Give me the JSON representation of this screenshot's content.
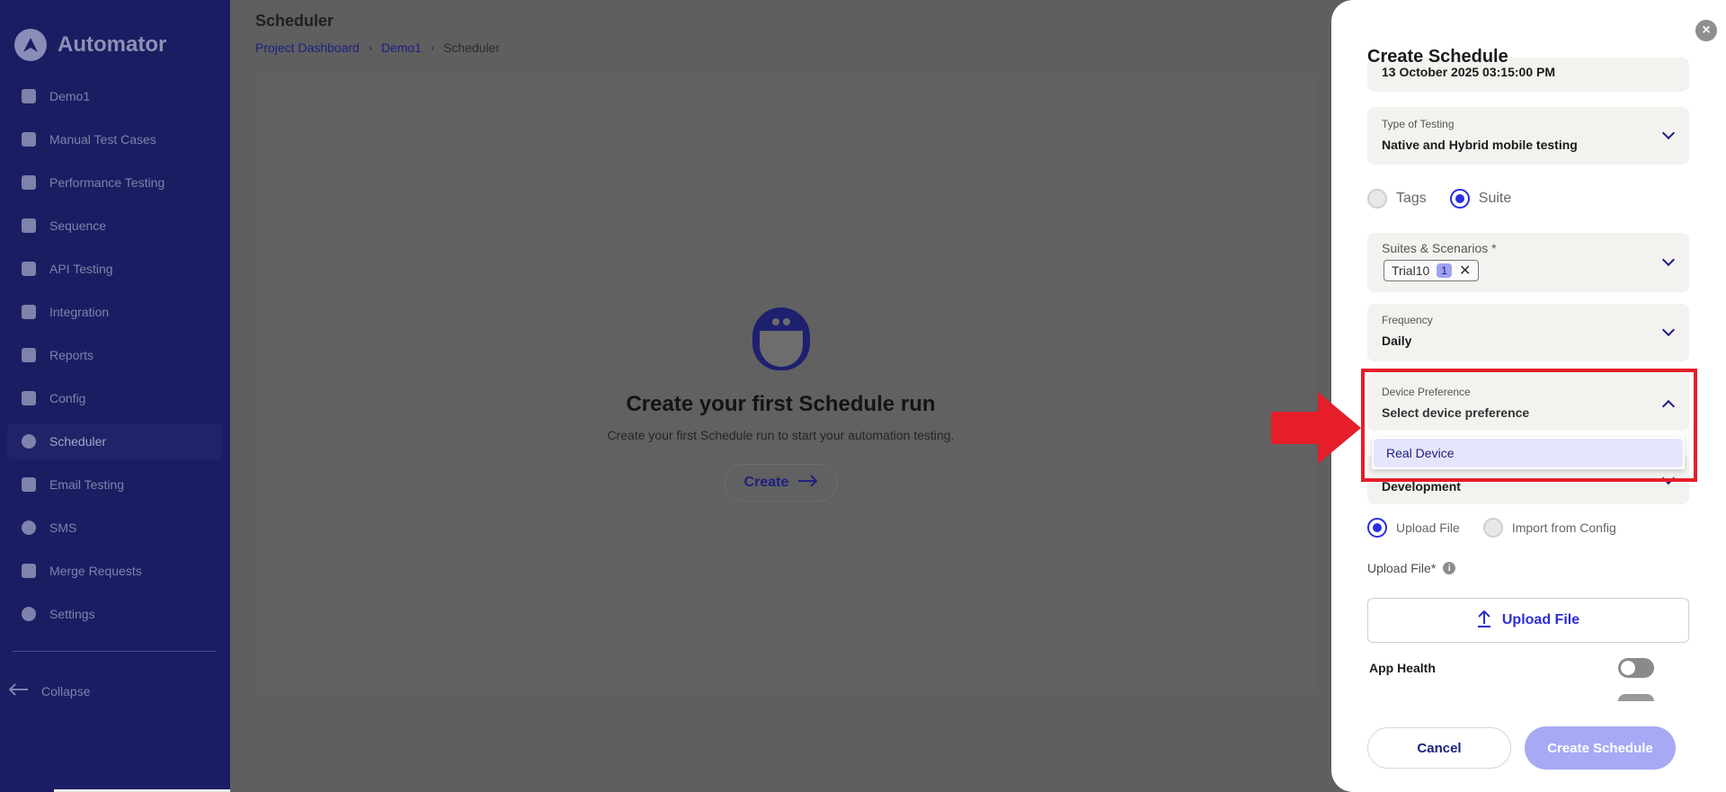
{
  "app": {
    "name": "Automator"
  },
  "sidebar": {
    "items": [
      {
        "label": "Demo1",
        "icon": "folder-icon"
      },
      {
        "label": "Manual Test Cases",
        "icon": "list-icon"
      },
      {
        "label": "Performance Testing",
        "icon": "robot-icon"
      },
      {
        "label": "Sequence",
        "icon": "document-icon"
      },
      {
        "label": "API Testing",
        "icon": "cloud-icon"
      },
      {
        "label": "Integration",
        "icon": "wrench-icon"
      },
      {
        "label": "Reports",
        "icon": "pie-chart-icon"
      },
      {
        "label": "Config",
        "icon": "config-icon"
      },
      {
        "label": "Scheduler",
        "icon": "clock-icon",
        "active": true
      },
      {
        "label": "Email Testing",
        "icon": "mail-icon"
      },
      {
        "label": "SMS",
        "icon": "chat-icon"
      },
      {
        "label": "Merge Requests",
        "icon": "merge-icon"
      },
      {
        "label": "Settings",
        "icon": "gear-icon"
      }
    ],
    "collapse_label": "Collapse"
  },
  "header": {
    "title": "Scheduler",
    "breadcrumb": [
      "Project Dashboard",
      "Demo1",
      "Scheduler"
    ]
  },
  "empty_state": {
    "title": "Create your first Schedule run",
    "subtitle": "Create your first Schedule run to start your automation testing.",
    "create_label": "Create"
  },
  "drawer": {
    "title": "Create Schedule",
    "date_value": "13 October 2025 03:15:00 PM",
    "type_of_testing": {
      "label": "Type of Testing",
      "value": "Native and Hybrid mobile testing"
    },
    "selection_mode": {
      "options": [
        "Tags",
        "Suite"
      ],
      "selected": "Suite"
    },
    "suites": {
      "label": "Suites & Scenarios *",
      "chip": "Trial10",
      "chip_count": "1"
    },
    "frequency": {
      "label": "Frequency",
      "value": "Daily"
    },
    "device_preference": {
      "label": "Device Preference",
      "placeholder": "Select device preference",
      "options": [
        "Real Device"
      ]
    },
    "environment_value": "Development",
    "upload_mode": {
      "options": [
        "Upload File",
        "Import from Config"
      ],
      "selected": "Upload File"
    },
    "upload_file_label": "Upload File*",
    "upload_button_label": "Upload File",
    "app_health_label": "App Health",
    "cancel_label": "Cancel",
    "submit_label": "Create Schedule"
  },
  "colors": {
    "accent": "#2b2fe0",
    "sidebar_bg": "#1b1d63",
    "highlight": "#e51e2a"
  }
}
